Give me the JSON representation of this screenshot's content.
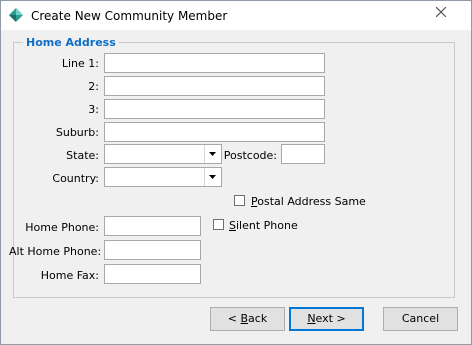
{
  "window": {
    "title": "Create New Community Member"
  },
  "group": {
    "label": "Home Address"
  },
  "fields": {
    "line1": {
      "label": "Line 1:",
      "value": ""
    },
    "line2": {
      "label": "2:",
      "value": ""
    },
    "line3": {
      "label": "3:",
      "value": ""
    },
    "suburb": {
      "label": "Suburb:",
      "value": ""
    },
    "state": {
      "label": "State:",
      "value": ""
    },
    "postcode": {
      "label": "Postcode:",
      "value": ""
    },
    "country": {
      "label": "Country:",
      "value": ""
    },
    "postal_same": {
      "label_prefix": "",
      "label_mnemonic": "P",
      "label_rest": "ostal Address Same",
      "checked": false
    },
    "home_phone": {
      "label": "Home Phone:",
      "value": ""
    },
    "silent_phone": {
      "label_mnemonic": "S",
      "label_rest": "ilent Phone",
      "checked": false
    },
    "alt_home_phone": {
      "label": "Alt Home Phone:",
      "value": ""
    },
    "home_fax": {
      "label": "Home Fax:",
      "value": ""
    }
  },
  "buttons": {
    "back": {
      "prefix": "< ",
      "mnemonic": "B",
      "rest": "ack"
    },
    "next": {
      "mnemonic": "N",
      "rest": "ext >"
    },
    "cancel": {
      "label": "Cancel"
    }
  },
  "icons": {
    "app": "diamond-app-icon",
    "close": "close-icon",
    "dropdown": "chevron-down-icon"
  },
  "colors": {
    "group_label": "#0f6fc6",
    "default_button_border": "#0078d7"
  }
}
